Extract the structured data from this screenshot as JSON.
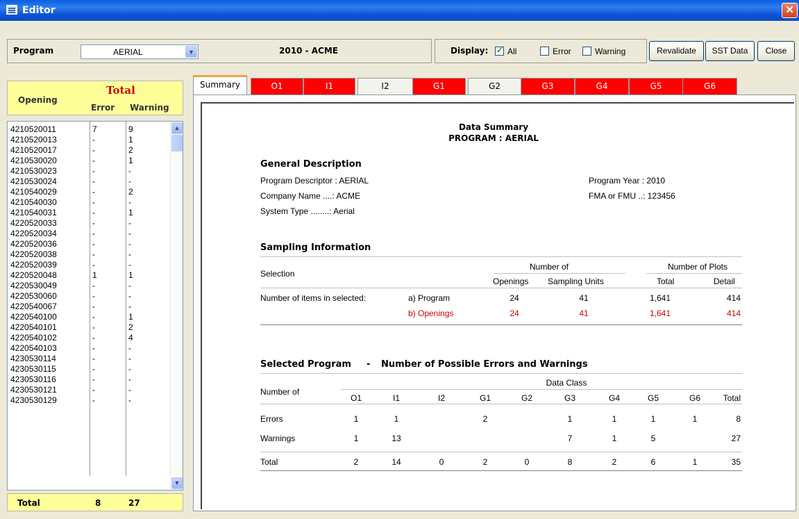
{
  "window": {
    "title": "Editor",
    "close_glyph": "✕"
  },
  "toolbar": {
    "program_label": "Program",
    "program_value": "AERIAL",
    "heading": "2010 - ACME",
    "display_label": "Display:",
    "all_label": "All",
    "error_label": "Error",
    "warning_label": "Warning",
    "all_checked": true,
    "error_checked": false,
    "warning_checked": false,
    "buttons": {
      "revalidate": "Revalidate",
      "sst_data": "SST Data",
      "close": "Close"
    }
  },
  "left": {
    "header": {
      "opening": "Opening",
      "total": "Total",
      "error": "Error",
      "warning": "Warning"
    },
    "rows": [
      {
        "opening": "4210520011",
        "error": "7",
        "warning": "9"
      },
      {
        "opening": "4210520013",
        "error": "-",
        "warning": "1"
      },
      {
        "opening": "4210520017",
        "error": "-",
        "warning": "2"
      },
      {
        "opening": "4210530020",
        "error": "-",
        "warning": "1"
      },
      {
        "opening": "4210530023",
        "error": "-",
        "warning": "-"
      },
      {
        "opening": "4210530024",
        "error": "-",
        "warning": "-"
      },
      {
        "opening": "4210540029",
        "error": "-",
        "warning": "2"
      },
      {
        "opening": "4210540030",
        "error": "-",
        "warning": "-"
      },
      {
        "opening": "4210540031",
        "error": "-",
        "warning": "1"
      },
      {
        "opening": "4220520033",
        "error": "-",
        "warning": "-"
      },
      {
        "opening": "4220520034",
        "error": "-",
        "warning": "-"
      },
      {
        "opening": "4220520036",
        "error": "-",
        "warning": "-"
      },
      {
        "opening": "4220520038",
        "error": "-",
        "warning": "-"
      },
      {
        "opening": "4220520039",
        "error": "-",
        "warning": "-"
      },
      {
        "opening": "4220520048",
        "error": "1",
        "warning": "1"
      },
      {
        "opening": "4220530049",
        "error": "-",
        "warning": "-"
      },
      {
        "opening": "4220530060",
        "error": "-",
        "warning": "-"
      },
      {
        "opening": "4220540067",
        "error": "-",
        "warning": "-"
      },
      {
        "opening": "4220540100",
        "error": "-",
        "warning": "1"
      },
      {
        "opening": "4220540101",
        "error": "-",
        "warning": "2"
      },
      {
        "opening": "4220540102",
        "error": "-",
        "warning": "4"
      },
      {
        "opening": "4220540103",
        "error": "-",
        "warning": "-"
      },
      {
        "opening": "4230530114",
        "error": "-",
        "warning": "-"
      },
      {
        "opening": "4230530115",
        "error": "-",
        "warning": "-"
      },
      {
        "opening": "4230530116",
        "error": "-",
        "warning": "-"
      },
      {
        "opening": "4230530121",
        "error": "-",
        "warning": "-"
      },
      {
        "opening": "4230530129",
        "error": "-",
        "warning": "-"
      }
    ],
    "footer": {
      "label": "Total",
      "error": "8",
      "warning": "27"
    }
  },
  "tabs": [
    {
      "label": "Summary",
      "style": "selected"
    },
    {
      "label": "O1",
      "style": "red"
    },
    {
      "label": "I1",
      "style": "red"
    },
    {
      "label": "I2",
      "style": "white"
    },
    {
      "label": "G1",
      "style": "red"
    },
    {
      "label": "G2",
      "style": "white"
    },
    {
      "label": "G3",
      "style": "red"
    },
    {
      "label": "G4",
      "style": "red"
    },
    {
      "label": "G5",
      "style": "red"
    },
    {
      "label": "G6",
      "style": "red"
    }
  ],
  "summary": {
    "title": "Data Summary",
    "subtitle": "PROGRAM :  AERIAL",
    "general": {
      "heading": "General Description",
      "descriptor": "Program Descriptor :  AERIAL",
      "company": "Company Name ....:  ACME",
      "system": "System Type ........:  Aerial",
      "year": "Program Year :  2010",
      "fma": "FMA or FMU ..:  123456"
    },
    "sampling": {
      "heading": "Sampling Information",
      "col_selection": "Selection",
      "col_number_of": "Number of",
      "col_number_plots": "Number of Plots",
      "col_openings": "Openings",
      "col_units": "Sampling Units",
      "col_total": "Total",
      "col_detail": "Detail",
      "row_label": "Number of items in selected:",
      "rows": [
        {
          "label": "a) Program",
          "openings": "24",
          "units": "41",
          "total": "1,641",
          "detail": "414",
          "highlight": false
        },
        {
          "label": "b) Openings",
          "openings": "24",
          "units": "41",
          "total": "1,641",
          "detail": "414",
          "highlight": true
        }
      ]
    },
    "errors": {
      "heading_a": "Selected Program",
      "heading_sep": "-",
      "heading_b": "Number of Possible Errors and Warnings",
      "data_class": "Data Class",
      "number_of": "Number of",
      "columns": [
        "O1",
        "I1",
        "I2",
        "G1",
        "G2",
        "G3",
        "G4",
        "G5",
        "G6",
        "Total"
      ],
      "rows": [
        {
          "label": "Errors",
          "values": [
            "1",
            "1",
            "",
            "2",
            "",
            "1",
            "1",
            "1",
            "1",
            "8"
          ]
        },
        {
          "label": "Warnings",
          "values": [
            "1",
            "13",
            "",
            "",
            "",
            "7",
            "1",
            "5",
            "",
            "27"
          ]
        },
        {
          "label": "Total",
          "values": [
            "2",
            "14",
            "0",
            "2",
            "0",
            "8",
            "2",
            "6",
            "1",
            "35"
          ]
        }
      ]
    }
  },
  "colors": {
    "tab_error": "#ff0000",
    "highlight_row": "#cc0000",
    "total_bg": "#ffff99",
    "title_red": "#cc0000"
  }
}
